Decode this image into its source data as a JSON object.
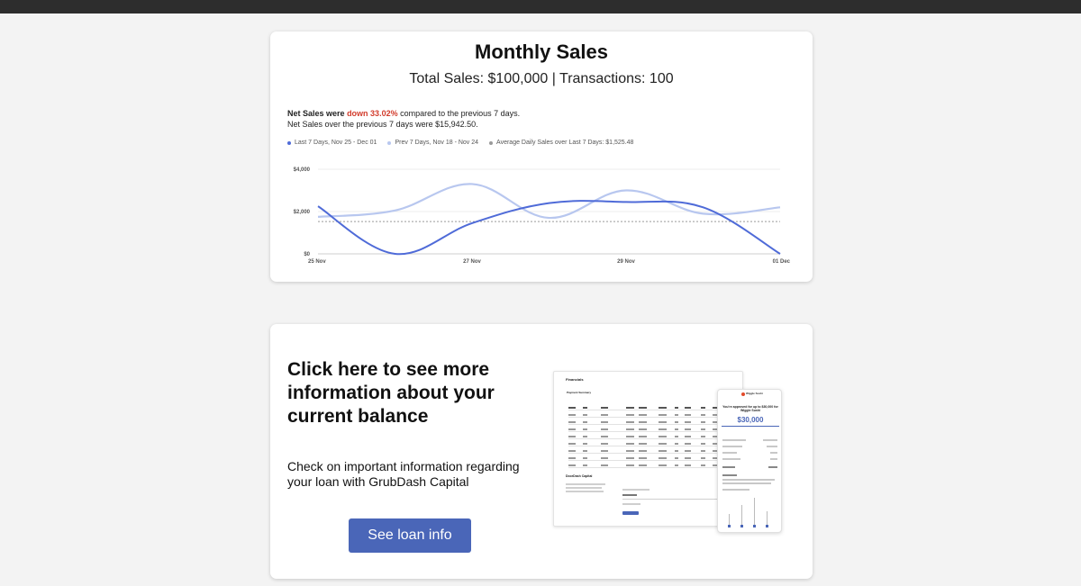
{
  "sales_card": {
    "title": "Monthly Sales",
    "subtitle": "Total Sales: $100,000 | Transactions: 100",
    "summary": {
      "lead": "Net Sales were",
      "change": "down 33.02%",
      "trail": "compared to the previous 7 days.",
      "previous": "Net Sales over the previous 7 days were $15,942.50."
    },
    "legend": [
      {
        "label": "Last 7 Days, Nov 25 - Dec 01",
        "color": "#4f6bd8"
      },
      {
        "label": "Prev 7 Days, Nov 18 - Nov 24",
        "color": "#b8c7ef"
      },
      {
        "label": "Average Daily Sales over Last 7 Days: $1,525.48",
        "color": "#9a9a9a"
      }
    ]
  },
  "chart_data": {
    "type": "line",
    "x": [
      "25 Nov",
      "26 Nov",
      "27 Nov",
      "28 Nov",
      "29 Nov",
      "30 Nov",
      "01 Dec"
    ],
    "x_tick_labels": [
      "25 Nov",
      "27 Nov",
      "29 Nov",
      "01 Dec"
    ],
    "y_tick_labels": [
      "$4,000",
      "$2,000",
      "$0"
    ],
    "ylim": [
      0,
      4000
    ],
    "grid": true,
    "series": [
      {
        "name": "Last 7 Days, Nov 25 - Dec 01",
        "color": "#4f6bd8",
        "values": [
          2250,
          0,
          1450,
          2400,
          2450,
          2200,
          0
        ]
      },
      {
        "name": "Prev 7 Days, Nov 18 - Nov 24",
        "color": "#b8c7ef",
        "values": [
          1750,
          2050,
          3300,
          1700,
          3000,
          1900,
          2200
        ]
      }
    ],
    "reference_line": {
      "name": "Average Daily Sales over Last 7 Days: $1,525.48",
      "value": 1525.48,
      "color": "#9a9a9a"
    }
  },
  "promo_card": {
    "title": "Click here to see more information about your current balance",
    "text": "Check on important information regarding your loan with GrubDash Capital",
    "button_label": "See loan info",
    "preview": {
      "financials_heading": "Financials",
      "payment_summary": "Payment Summary",
      "capital_heading": "DoorDash Capital",
      "approval_text": "You're approved for up to $30,000 for Wiggle Sushi",
      "approval_amount": "$30,000",
      "merchant_label": "Wiggle Sushi"
    }
  }
}
